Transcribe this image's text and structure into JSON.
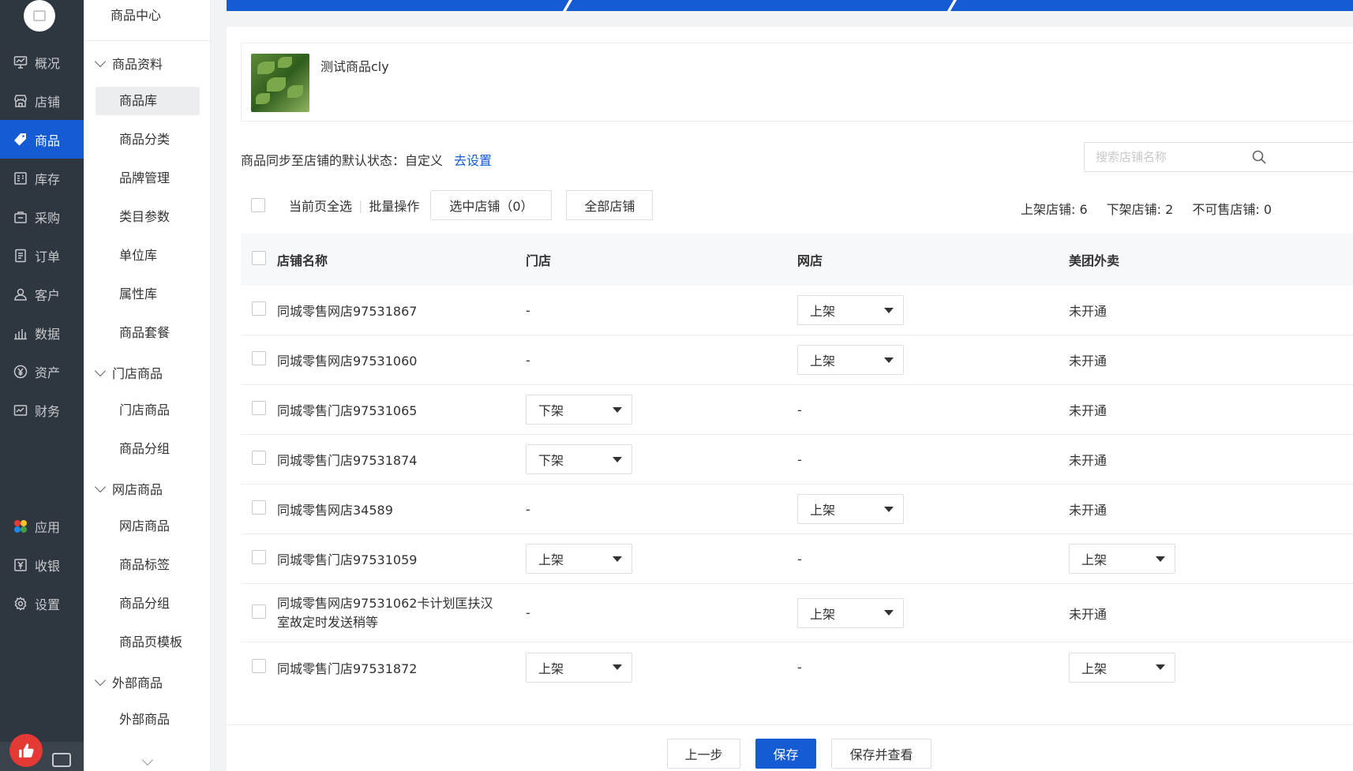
{
  "nav": {
    "items": [
      {
        "label": "概况",
        "icon": "overview-icon"
      },
      {
        "label": "店铺",
        "icon": "store-icon"
      },
      {
        "label": "商品",
        "icon": "tag-icon",
        "active": true
      },
      {
        "label": "库存",
        "icon": "inventory-icon"
      },
      {
        "label": "采购",
        "icon": "purchase-icon"
      },
      {
        "label": "订单",
        "icon": "order-icon"
      },
      {
        "label": "客户",
        "icon": "customer-icon"
      },
      {
        "label": "数据",
        "icon": "chart-icon"
      },
      {
        "label": "资产",
        "icon": "yen-icon"
      },
      {
        "label": "财务",
        "icon": "finance-icon"
      }
    ],
    "bottom_items": [
      {
        "label": "应用",
        "icon": "apps-icon"
      },
      {
        "label": "收银",
        "icon": "cashier-icon"
      },
      {
        "label": "设置",
        "icon": "gear-icon"
      }
    ]
  },
  "subnav": {
    "title": "商品中心",
    "groups": [
      {
        "label": "商品资料",
        "items": [
          "商品库",
          "商品分类",
          "品牌管理",
          "类目参数",
          "单位库",
          "属性库",
          "商品套餐"
        ]
      },
      {
        "label": "门店商品",
        "items": [
          "门店商品",
          "商品分组"
        ]
      },
      {
        "label": "网店商品",
        "items": [
          "网店商品",
          "商品标签",
          "商品分组",
          "商品页模板"
        ]
      },
      {
        "label": "外部商品",
        "items": [
          "外部商品"
        ]
      }
    ]
  },
  "product": {
    "name": "测试商品cly"
  },
  "sync": {
    "label": "商品同步至店铺的默认状态：自定义",
    "link": "去设置"
  },
  "search": {
    "placeholder": "搜索店铺名称"
  },
  "batch": {
    "select_all": "当前页全选",
    "batch_ops": "批量操作",
    "selected_btn": "选中店铺（0）",
    "all_btn": "全部店铺"
  },
  "counts": {
    "on": "上架店铺: 6",
    "off": "下架店铺: 2",
    "unsellable": "不可售店铺: 0"
  },
  "table": {
    "headers": [
      "店铺名称",
      "门店",
      "网店",
      "美团外卖"
    ],
    "rows": [
      {
        "name": "同城零售网店97531867",
        "store": "-",
        "online": "上架",
        "meituan": "未开通"
      },
      {
        "name": "同城零售网店97531060",
        "store": "-",
        "online": "上架",
        "meituan": "未开通"
      },
      {
        "name": "同城零售门店97531065",
        "store": "下架",
        "online": "-",
        "meituan": "未开通"
      },
      {
        "name": "同城零售门店97531874",
        "store": "下架",
        "online": "-",
        "meituan": "未开通"
      },
      {
        "name": "同城零售网店34589",
        "store": "-",
        "online": "上架",
        "meituan": "未开通"
      },
      {
        "name": "同城零售门店97531059",
        "store": "上架",
        "online": "-",
        "meituan": "上架"
      },
      {
        "name": "同城零售网店97531062卡计划匡扶汉室故定时发送稍等",
        "store": "-",
        "online": "上架",
        "meituan": "未开通"
      },
      {
        "name": "同城零售门店97531872",
        "store": "上架",
        "online": "-",
        "meituan": "上架"
      }
    ]
  },
  "footer": {
    "prev": "上一步",
    "save": "保存",
    "save_view": "保存并查看"
  },
  "colors": {
    "primary": "#155bd4",
    "nav_bg": "#2e3640"
  }
}
